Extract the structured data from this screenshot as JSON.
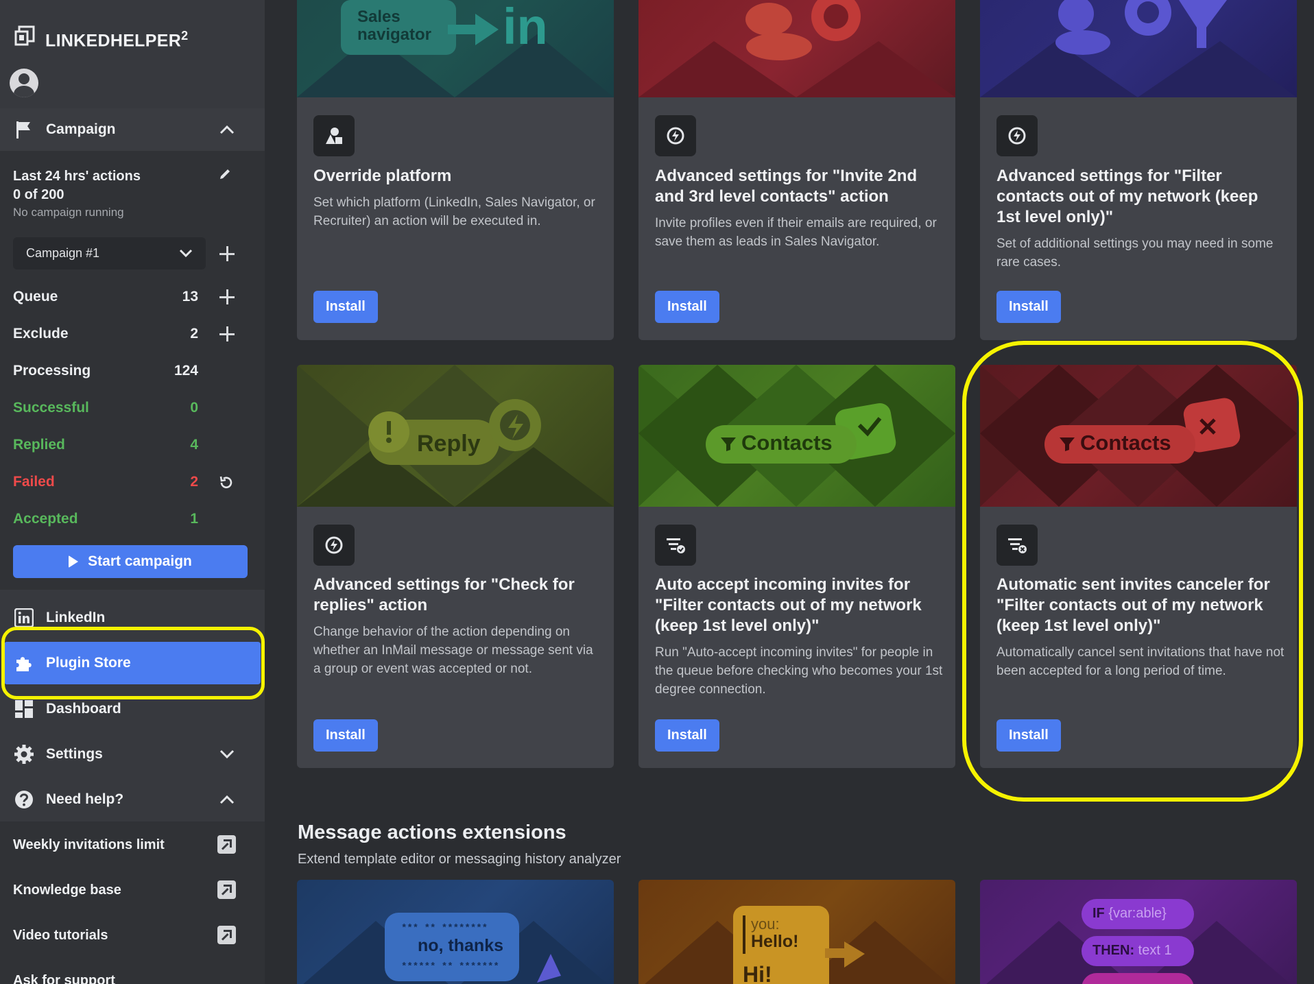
{
  "app": {
    "name": "LINKEDHELPER",
    "version_sup": "2"
  },
  "sidebar": {
    "campaign_section": "Campaign",
    "stats_title": "Last 24 hrs' actions",
    "stats_count": "0 of 200",
    "stats_status": "No campaign running",
    "campaign_select": "Campaign #1",
    "stats": [
      {
        "label": "Queue",
        "value": "13",
        "color": "white"
      },
      {
        "label": "Exclude",
        "value": "2",
        "color": "white"
      },
      {
        "label": "Processing",
        "value": "124",
        "color": "white"
      },
      {
        "label": "Successful",
        "value": "0",
        "color": "green"
      },
      {
        "label": "Replied",
        "value": "4",
        "color": "green"
      },
      {
        "label": "Failed",
        "value": "2",
        "color": "red"
      },
      {
        "label": "Accepted",
        "value": "1",
        "color": "green"
      }
    ],
    "start_button": "Start campaign",
    "nav": {
      "linkedin": "LinkedIn",
      "plugin_store": "Plugin Store",
      "dashboard": "Dashboard",
      "settings": "Settings",
      "need_help": "Need help?"
    },
    "help_links": [
      "Weekly invitations limit",
      "Knowledge base",
      "Video tutorials",
      "Ask for support"
    ]
  },
  "cards": [
    {
      "title": "Override platform",
      "desc": "Set which platform (LinkedIn, Sales Navigator, or Recruiter) an action will be executed in.",
      "button": "Install",
      "banner_text_1": "Sales",
      "banner_text_2": "navigator",
      "banner_text_3": "in"
    },
    {
      "title": "Advanced settings for \"Invite 2nd and 3rd level contacts\" action",
      "desc": "Invite profiles even if their emails are required, or save them as leads in Sales Navigator.",
      "button": "Install"
    },
    {
      "title": "Advanced settings for \"Filter contacts out of my network (keep 1st level only)\"",
      "desc": "Set of additional settings you may need in some rare cases.",
      "button": "Install"
    },
    {
      "title": "Advanced settings for \"Check for replies\" action",
      "desc": "Change behavior of the action depending on whether an InMail message or message sent via a group or event was accepted or not.",
      "button": "Install",
      "banner_text": "Reply"
    },
    {
      "title": "Auto accept incoming invites for \"Filter contacts out of my network (keep 1st level only)\"",
      "desc": "Run \"Auto-accept incoming invites\" for people in the queue before checking who becomes your 1st degree connection.",
      "button": "Install",
      "banner_text": "Contacts"
    },
    {
      "title": "Automatic sent invites canceler for \"Filter contacts out of my network (keep 1st level only)\"",
      "desc": "Automatically cancel sent invitations that have not been accepted for a long period of time.",
      "button": "Install",
      "banner_text": "Contacts"
    }
  ],
  "section": {
    "title": "Message actions extensions",
    "subtitle": "Extend template editor or messaging history analyzer"
  },
  "bottom_banners": {
    "b1_text": "no, thanks",
    "b2_you": "you:",
    "b2_hello": "Hello!",
    "b2_hi": "Hi!",
    "b3_if": "IF",
    "b3_var": "{var:able}",
    "b3_then": "THEN:",
    "b3_text": "text 1"
  },
  "colors": {
    "accent": "#4b7cf0",
    "highlight": "#f6f300",
    "green": "#58b85c",
    "red": "#ee4a4a"
  }
}
